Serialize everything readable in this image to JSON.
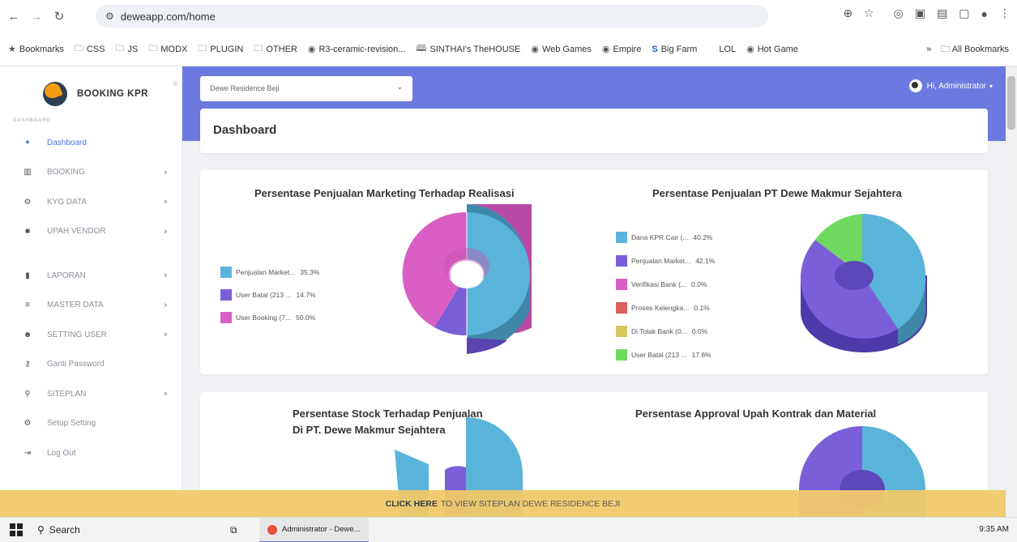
{
  "browser": {
    "url": "deweapp.com/home",
    "bookmarks": [
      {
        "icon": "star-icon",
        "label": "Bookmarks"
      },
      {
        "icon": "folder-icon",
        "label": "CSS"
      },
      {
        "icon": "folder-icon",
        "label": "JS"
      },
      {
        "icon": "folder-icon",
        "label": "MODX"
      },
      {
        "icon": "folder-icon",
        "label": "PLUGIN"
      },
      {
        "icon": "folder-icon",
        "label": "OTHER"
      },
      {
        "icon": "globe-icon",
        "label": "R3-ceramic-revision..."
      },
      {
        "icon": "bookmark-icon",
        "label": "SINTHAI's TheHOUSE"
      },
      {
        "icon": "globe-icon",
        "label": "Web Games"
      },
      {
        "icon": "globe-icon",
        "label": "Empire"
      },
      {
        "icon": "s-logo-icon",
        "label": "Big Farm"
      },
      {
        "icon": "none",
        "label": "LOL"
      },
      {
        "icon": "globe-icon",
        "label": "Hot Game"
      }
    ],
    "more": "»",
    "all_bookmarks": "All Bookmarks"
  },
  "sidebar": {
    "brand": "BOOKING KPR",
    "section": "DASHBOARD",
    "items": [
      {
        "label": "Dashboard",
        "icon": "dashboard-icon",
        "has_arrow": false
      },
      {
        "label": "BOOKING",
        "icon": "table-icon",
        "has_arrow": true
      },
      {
        "label": "KYG DATA",
        "icon": "gear-icon",
        "has_arrow": true
      },
      {
        "label": "UPAH VENDOR",
        "icon": "folder-icon",
        "has_arrow": true
      },
      {
        "label": "LAPORAN",
        "icon": "chart-icon",
        "has_arrow": true
      },
      {
        "label": "MASTER DATA",
        "icon": "list-icon",
        "has_arrow": true
      },
      {
        "label": "SETTING USER",
        "icon": "users-icon",
        "has_arrow": true
      },
      {
        "label": "Ganti Password",
        "icon": "key-icon",
        "has_arrow": false
      },
      {
        "label": "SITEPLAN",
        "icon": "map-pin-icon",
        "has_arrow": true
      },
      {
        "label": "Setup Setting",
        "icon": "cogs-icon",
        "has_arrow": false
      },
      {
        "label": "Log Out",
        "icon": "logout-icon",
        "has_arrow": false
      }
    ],
    "arrow": "›"
  },
  "topbar": {
    "project_select": "Dewe Residence Beji",
    "user": "Hi, Administrator"
  },
  "page": {
    "title": "Dashboard"
  },
  "charts": {
    "marketing": {
      "title": "Persentase Penjualan Marketing Terhadap Realisasi",
      "legend": [
        {
          "label": "Penjualan Market...",
          "pct": "35.3%",
          "color": "#5ab4d9"
        },
        {
          "label": "User Batal (213 ...",
          "pct": "14.7%",
          "color": "#7b5fd9"
        },
        {
          "label": "User Booking (7...",
          "pct": "50.0%",
          "color": "#d95fc4"
        }
      ]
    },
    "pt": {
      "title": "Persentase Penjualan PT Dewe Makmur Sejahtera",
      "legend": [
        {
          "label": "Dana KPR Cair (...",
          "pct": "40.2%",
          "color": "#5ab4d9"
        },
        {
          "label": "Penjualan Market...",
          "pct": "42.1%",
          "color": "#7b5fd9"
        },
        {
          "label": "Verifikasi Bank (...",
          "pct": "0.0%",
          "color": "#d95fc4"
        },
        {
          "label": "Proses Kelengka...",
          "pct": "0.1%",
          "color": "#d9605f"
        },
        {
          "label": "Di Tolak Bank (0...",
          "pct": "0.0%",
          "color": "#d9c75f"
        },
        {
          "label": "User Batal (213 ...",
          "pct": "17.6%",
          "color": "#6fd95f"
        }
      ]
    },
    "stock": {
      "title_line1": "Persentase Stock Terhadap Penjualan",
      "title_line2": "Di PT. Dewe Makmur Sejahtera"
    },
    "approval": {
      "title": "Persentase Approval Upah Kontrak dan Material"
    }
  },
  "banner": {
    "bold": "CLICK HERE",
    "rest": "TO VIEW SITEPLAN DEWE RESIDENCE BEJI"
  },
  "taskbar": {
    "search": "Search",
    "app": "Administrator - Dewe...",
    "time": "9:35 AM"
  }
}
